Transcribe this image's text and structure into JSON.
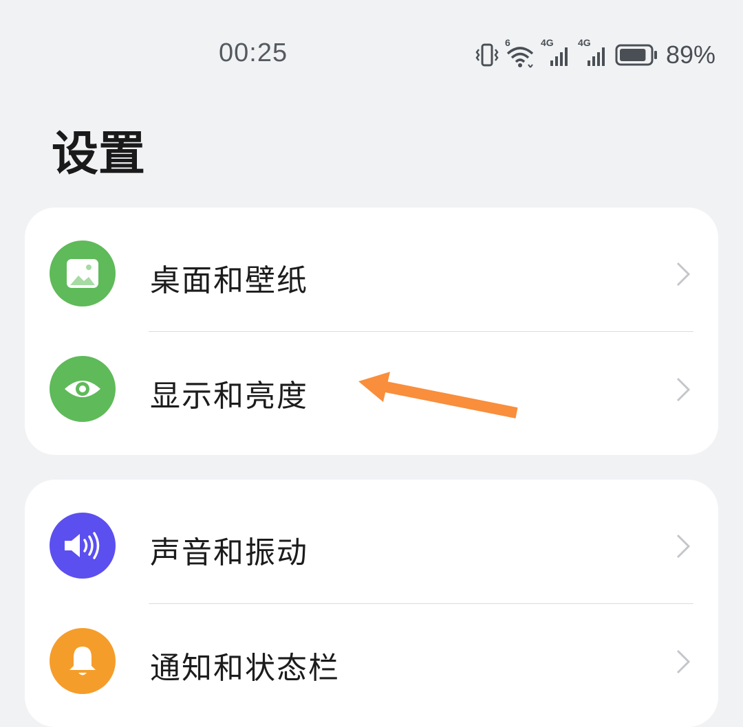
{
  "status_bar": {
    "time": "00:25",
    "battery_percent": "89%",
    "network_badges": [
      "6",
      "4G",
      "4G"
    ],
    "icons": [
      "vibrate-icon",
      "wifi-icon",
      "signal-icon",
      "signal-icon",
      "battery-icon"
    ],
    "battery_level": 0.89
  },
  "page": {
    "title": "设置"
  },
  "groups": [
    {
      "items": [
        {
          "label": "桌面和壁纸",
          "icon": "wallpaper-icon",
          "icon_color": "#5fba5a"
        },
        {
          "label": "显示和亮度",
          "icon": "eye-icon",
          "icon_color": "#5fba5a"
        }
      ]
    },
    {
      "items": [
        {
          "label": "声音和振动",
          "icon": "speaker-icon",
          "icon_color": "#5b4ff0"
        },
        {
          "label": "通知和状态栏",
          "icon": "bell-icon",
          "icon_color": "#f59d2a"
        }
      ]
    }
  ],
  "annotation": {
    "type": "arrow",
    "color": "#f98e3c",
    "points_to": "显示和亮度"
  },
  "colors": {
    "background": "#f1f2f4",
    "card": "#ffffff",
    "chevron": "#c4c6ca"
  }
}
